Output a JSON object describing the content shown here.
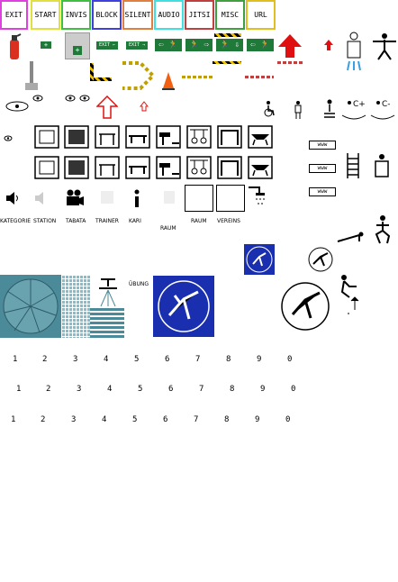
{
  "tabs": [
    {
      "label": "EXIT",
      "color": "#e040e0"
    },
    {
      "label": "START",
      "color": "#e0e040"
    },
    {
      "label": "INVIS",
      "color": "#40c040"
    },
    {
      "label": "BLOCK",
      "color": "#4040e0"
    },
    {
      "label": "SILENT",
      "color": "#e08040"
    },
    {
      "label": "AUDIO",
      "color": "#40e0e0"
    },
    {
      "label": "JITSI",
      "color": "#c04040"
    },
    {
      "label": "MISC",
      "color": "#40a040"
    },
    {
      "label": "URL",
      "color": "#e0c020"
    }
  ],
  "icon_labels": [
    "KATEGORIE",
    "STATION",
    "TABATA",
    "TRAINER",
    "KARI",
    "RAUM",
    "RAUM",
    "VEREINS"
  ],
  "uebung": "ÜBUNG",
  "www": [
    "www",
    "www",
    "www"
  ],
  "numbers": {
    "row1": [
      "1",
      "2",
      "3",
      "4",
      "5",
      "6",
      "7",
      "8",
      "9",
      "0"
    ],
    "row2": [
      "1",
      "2",
      "3",
      "4",
      "5",
      "6",
      "7",
      "8",
      "9",
      "0"
    ],
    "row3": [
      "1",
      "2",
      "3",
      "4",
      "5",
      "6",
      "7",
      "8",
      "9",
      "0"
    ]
  },
  "colors": {
    "exit_green": "#1f7a3a",
    "arrow_red": "#e01010",
    "blue_sign": "#1a2fb0",
    "teal": "#4b8a98"
  }
}
